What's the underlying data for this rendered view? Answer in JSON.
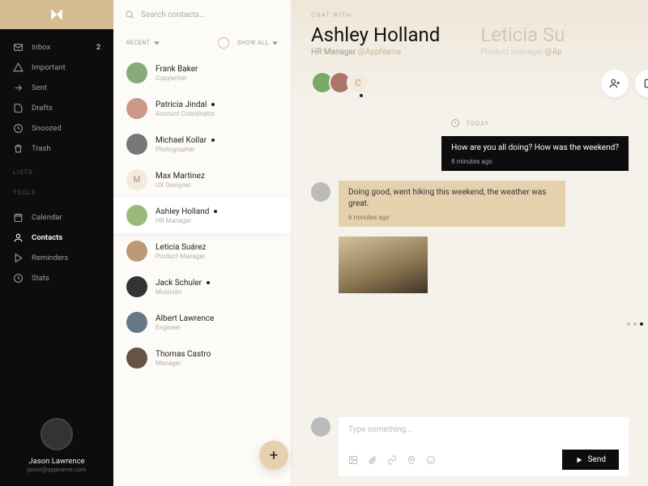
{
  "sidebar": {
    "nav": [
      {
        "icon": "inbox",
        "label": "Inbox",
        "badge": "2"
      },
      {
        "icon": "important",
        "label": "Important"
      },
      {
        "icon": "sent",
        "label": "Sent"
      },
      {
        "icon": "drafts",
        "label": "Drafts"
      },
      {
        "icon": "snoozed",
        "label": "Snoozed"
      },
      {
        "icon": "trash",
        "label": "Trash"
      }
    ],
    "lists_header": "LISTS",
    "tools_header": "TOOLS",
    "tools": [
      {
        "icon": "calendar",
        "label": "Calendar"
      },
      {
        "icon": "contacts",
        "label": "Contacts",
        "active": true
      },
      {
        "icon": "reminders",
        "label": "Reminders"
      },
      {
        "icon": "stats",
        "label": "Stats"
      }
    ],
    "profile": {
      "name": "Jason Lawrence",
      "email": "jason@appname.com"
    }
  },
  "contacts_panel": {
    "search_placeholder": "Search contacts...",
    "filter_left": "RECENT",
    "filter_right": "SHOW ALL",
    "items": [
      {
        "name": "Frank Baker",
        "role": "Copywriter",
        "dot": false
      },
      {
        "name": "Patricia Jindal",
        "role": "Account Coordinator",
        "dot": true
      },
      {
        "name": "Michael Kollar",
        "role": "Photographer",
        "dot": true
      },
      {
        "name": "Max Martinez",
        "role": "UX Designer",
        "dot": false,
        "initial": "M"
      },
      {
        "name": "Ashley Holland",
        "role": "HR Manager",
        "dot": true,
        "selected": true
      },
      {
        "name": "Leticia Suárez",
        "role": "Product Manager",
        "dot": false
      },
      {
        "name": "Jack Schuler",
        "role": "Musician",
        "dot": true
      },
      {
        "name": "Albert Lawrence",
        "role": "Engineer",
        "dot": false
      },
      {
        "name": "Thomas Castro",
        "role": "Manager",
        "dot": false
      }
    ]
  },
  "chat": {
    "eyebrow": "CHAT WITH",
    "active": {
      "name": "Ashley Holland",
      "role": "HR Manager",
      "app": "@AppName"
    },
    "next": {
      "name": "Leticia Su",
      "role": "Product manager",
      "app": "@Ap"
    },
    "participants_initial": "C",
    "today_label": "TODAY",
    "messages": [
      {
        "side": "right",
        "style": "dark",
        "text": "How are you all doing? How was the weekend?",
        "time": "8 minutes ago"
      },
      {
        "side": "left",
        "style": "tan",
        "text": "Doing good, went hiking this weekend, the weather was great.",
        "time": "6 minutes ago"
      }
    ],
    "composer_placeholder": "Type something...",
    "send_label": "Send"
  }
}
